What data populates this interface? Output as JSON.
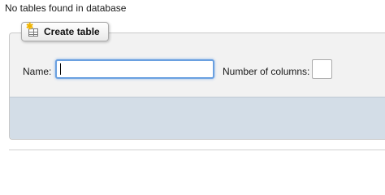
{
  "notice": {
    "text": "No tables found in database"
  },
  "create_table": {
    "legend_label": "Create table",
    "legend_icon": "table-add-icon",
    "name_label": "Name:",
    "name_value": "",
    "columns_label": "Number of columns:",
    "columns_value": ""
  },
  "colors": {
    "panel_background": "#f2f2f2",
    "footer_band": "#d3dde7",
    "focus_border": "#6aa0e0"
  }
}
